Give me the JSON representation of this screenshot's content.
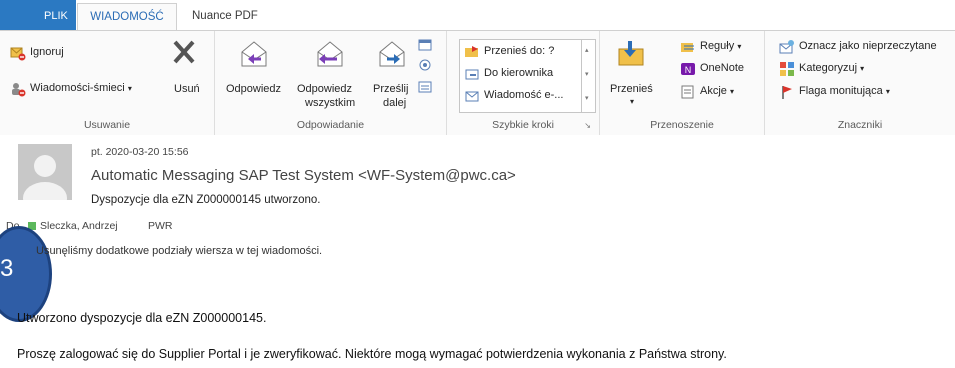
{
  "tabs": {
    "file": "PLIK",
    "active": "WIADOMOŚĆ",
    "nuance": "Nuance PDF"
  },
  "ribbon": {
    "delete_group": {
      "ignore": "Ignoruj",
      "junk": "Wiadomości-śmieci",
      "delete": "Usuń",
      "label": "Usuwanie"
    },
    "respond_group": {
      "reply": "Odpowiedz",
      "reply_all_1": "Odpowiedz",
      "reply_all_2": "wszystkim",
      "forward_1": "Prześlij",
      "forward_2": "dalej",
      "label": "Odpowiadanie"
    },
    "quick_steps": {
      "items": [
        "Przenieś do: ?",
        "Do kierownika",
        "Wiadomość e-..."
      ],
      "label": "Szybkie kroki"
    },
    "move_group": {
      "move": "Przenieś",
      "rules": "Reguły",
      "onenote": "OneNote",
      "actions": "Akcje",
      "label": "Przenoszenie"
    },
    "tags_group": {
      "mark_unread": "Oznacz jako nieprzeczytane",
      "categorize": "Kategoryzuj",
      "follow_up": "Flaga monitująca",
      "label": "Znaczniki"
    }
  },
  "message": {
    "date": "pt. 2020-03-20 15:56",
    "sender": "Automatic Messaging SAP Test System <WF-System@pwc.ca>",
    "subject": "Dyspozycje dla eZN Z000000145 utworzono.",
    "to_label": "Do",
    "recipient": "Sleczka, Andrzej",
    "cc": "PWR",
    "info": "Usunęliśmy dodatkowe podziały wiersza w tej wiadomości.",
    "badge": "3",
    "body_line1": "Utworzono dyspozycje dla eZN Z000000145.",
    "body_line2": "Proszę zalogować się do Supplier Portal i je zweryfikować. Niektóre mogą wymagać potwierdzenia wykonania z Państwa strony."
  }
}
